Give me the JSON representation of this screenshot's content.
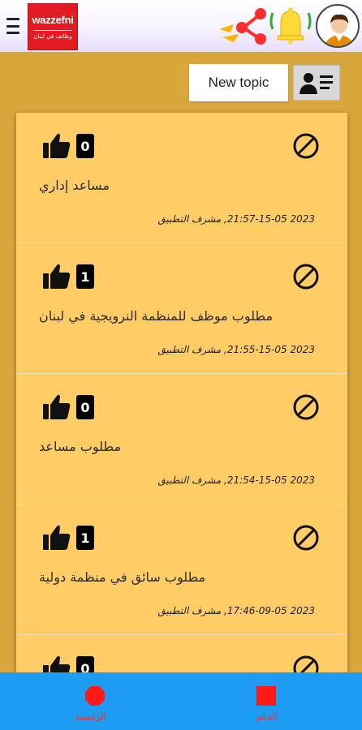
{
  "header": {
    "logo_title": "wazzefni",
    "logo_subtitle": "وظائف في لبنان",
    "icons": [
      "menu-icon",
      "share-icon",
      "bell-icon",
      "avatar"
    ]
  },
  "actions": {
    "new_topic_label": "New topic",
    "profile_list_icon": "person-list-icon"
  },
  "topics": [
    {
      "likes": "0",
      "title": "مساعد إداري",
      "author": "مشرف التطبيق",
      "date": "2023 21:57-15-05"
    },
    {
      "likes": "1",
      "title": "مطلوب موظف للمنظمة النرويجية في لبنان",
      "author": "مشرف التطبيق",
      "date": "2023 21:55-15-05"
    },
    {
      "likes": "0",
      "title": "مطلوب مساعد",
      "author": "مشرف التطبيق",
      "date": "2023 21:54-15-05"
    },
    {
      "likes": "1",
      "title": "مطلوب سائق في منظمة دولية",
      "author": "مشرف التطبيق",
      "date": "2023 17:46-09-05"
    },
    {
      "likes": "0",
      "title": "",
      "author": "",
      "date": ""
    }
  ],
  "bottom_nav": {
    "home_label": "الرئيسية",
    "support_label": "الدعم"
  },
  "colors": {
    "background": "#d9a63c",
    "card": "#ffcc66",
    "nav": "#1e9bf2",
    "nav_icon": "#ff1a1a"
  }
}
